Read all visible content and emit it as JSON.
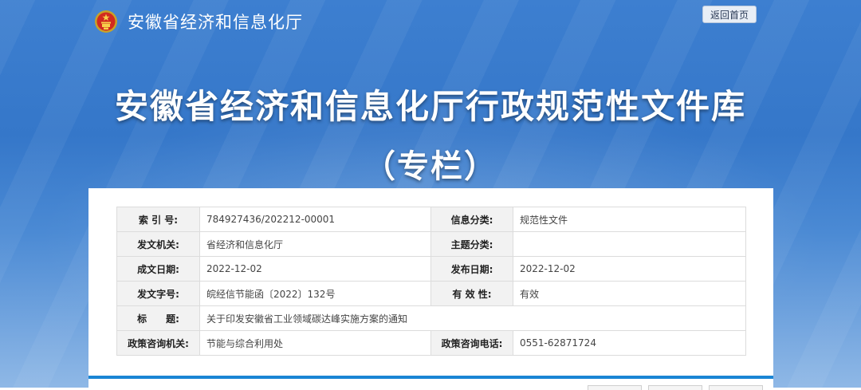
{
  "header": {
    "site_name": "安徽省经济和信息化厅",
    "home_label": "返回首页"
  },
  "banner": {
    "title_line1": "安徽省经济和信息化厅行政规范性文件库",
    "title_line2": "（专栏）"
  },
  "meta": {
    "index_label": "索 引 号:",
    "index_value": "784927436/202212-00001",
    "category_label": "信息分类:",
    "category_value": "规范性文件",
    "issuer_label": "发文机关:",
    "issuer_value": "省经济和信息化厅",
    "topic_label": "主题分类:",
    "topic_value": "",
    "created_label": "成文日期:",
    "created_value": "2022-12-02",
    "published_label": "发布日期:",
    "published_value": "2022-12-02",
    "docno_label": "发文字号:",
    "docno_value": "皖经信节能函〔2022〕132号",
    "validity_label": "有 效 性:",
    "validity_value": "有效",
    "title_label": "标　　题:",
    "title_value": "关于印发安徽省工业领域碳达峰实施方案的通知",
    "consult_org_label": "政策咨询机关:",
    "consult_org_value": "节能与综合利用处",
    "consult_phone_label": "政策咨询电话:",
    "consult_phone_value": "0551-62871724"
  },
  "colors": {
    "banner_blue": "#3577c9",
    "accent_bar": "#1a85d4",
    "label_bg": "#f2f2f2"
  }
}
